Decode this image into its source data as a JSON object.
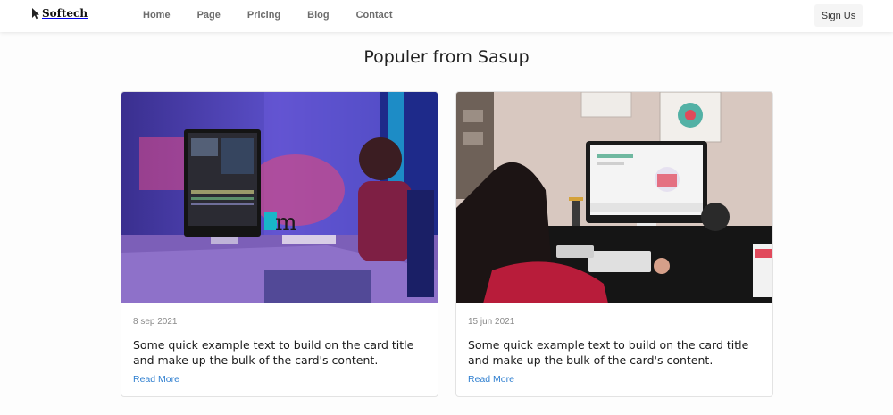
{
  "brand": {
    "name": "Softech",
    "icon": "cursor-arrow-icon"
  },
  "nav": {
    "links": [
      "Home",
      "Page",
      "Pricing",
      "Blog",
      "Contact"
    ]
  },
  "signup": {
    "label": "Sign Us"
  },
  "section": {
    "title": "Populer from Sasup"
  },
  "cards": [
    {
      "date": "8 sep 2021",
      "text": "Some quick example text to build on the card title and make up the bulk of the card's content.",
      "link": "Read More"
    },
    {
      "date": "15 jun 2021",
      "text": "Some quick example text to build on the card title and make up the bulk of the card's content.",
      "link": "Read More"
    }
  ],
  "colors": {
    "link": "#2f7fd0",
    "nav_text": "#6c6c6c",
    "card_border": "#e3e3e3"
  }
}
